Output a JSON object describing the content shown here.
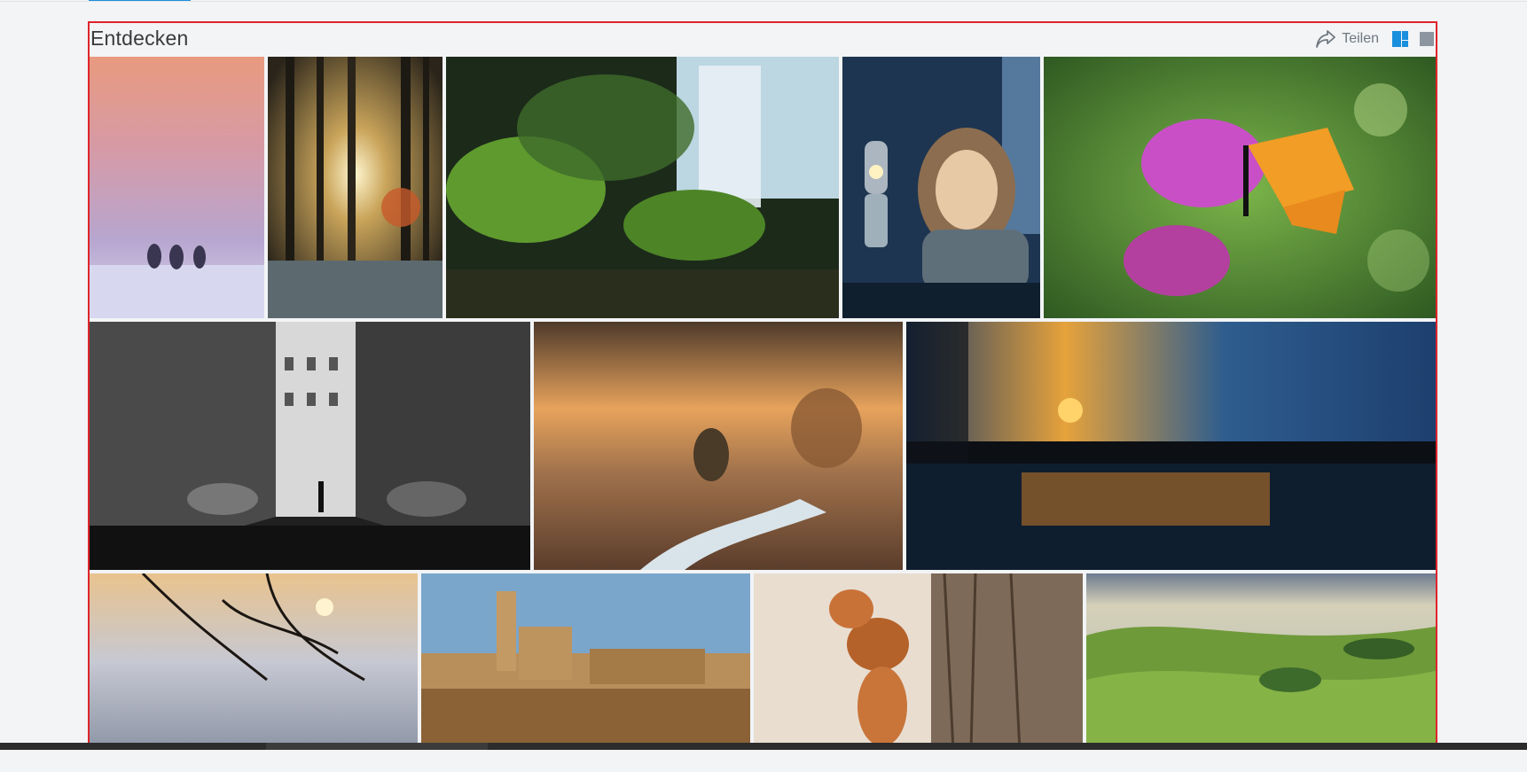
{
  "section": {
    "title": "Entdecken",
    "share_label": "Teilen"
  },
  "icons": {
    "share": "share-arrow-icon",
    "tile_view": "mosaic-view-icon",
    "grid_view": "grid-view-icon"
  },
  "colors": {
    "accent": "#1a8fdd",
    "selection_border": "#e0242b",
    "background": "#f2f4f6",
    "title": "#3a3a3a",
    "muted": "#6f7780"
  },
  "photos": [
    {
      "subject": "winter-trees-pink-sky"
    },
    {
      "subject": "forest-sun-rays"
    },
    {
      "subject": "fern-waterfall"
    },
    {
      "subject": "child-with-oil-lamp"
    },
    {
      "subject": "monarch-butterfly-flower"
    },
    {
      "subject": "black-white-street"
    },
    {
      "subject": "autumn-stream-landscape"
    },
    {
      "subject": "lake-sunset-reflection"
    },
    {
      "subject": "frozen-branches-sunset"
    },
    {
      "subject": "hilltop-old-town"
    },
    {
      "subject": "red-squirrel-tree"
    },
    {
      "subject": "green-rolling-hills"
    }
  ]
}
